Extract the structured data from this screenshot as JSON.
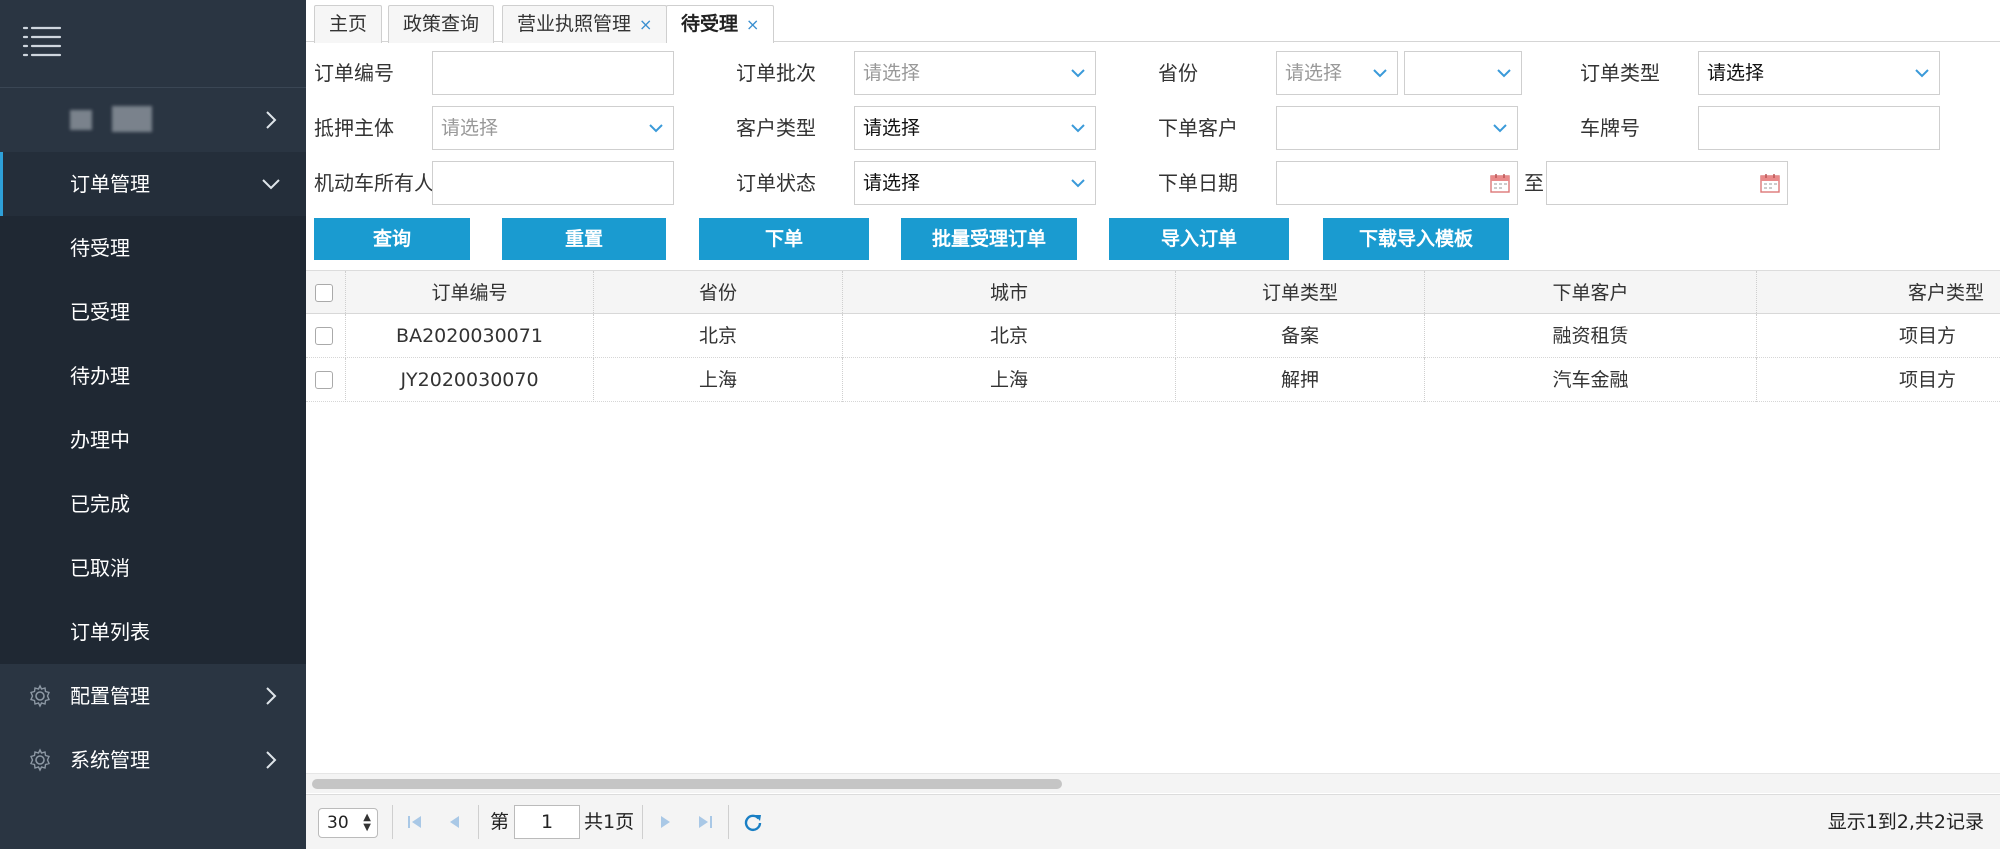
{
  "sidebar": {
    "menu_open": "订单管理",
    "sub_items": [
      "待受理",
      "已受理",
      "待办理",
      "办理中",
      "已完成",
      "已取消",
      "订单列表"
    ],
    "groups": [
      "配置管理",
      "系统管理"
    ]
  },
  "tabs": [
    {
      "label": "主页",
      "closable": false
    },
    {
      "label": "政策查询",
      "closable": false
    },
    {
      "label": "营业执照管理",
      "closable": true
    },
    {
      "label": "待受理",
      "closable": true,
      "active": true
    }
  ],
  "tab_close_glyph": "×",
  "form": {
    "order_no_label": "订单编号",
    "order_batch_label": "订单批次",
    "order_batch_placeholder": "请选择",
    "province_label": "省份",
    "province_placeholder": "请选择",
    "order_type_label": "订单类型",
    "order_type_value": "请选择",
    "pledge_label": "抵押主体",
    "pledge_placeholder": "请选择",
    "customer_type_label": "客户类型",
    "customer_type_value": "请选择",
    "order_customer_label": "下单客户",
    "plate_label": "车牌号",
    "owner_label": "机动车所有人",
    "order_status_label": "订单状态",
    "order_status_value": "请选择",
    "order_date_label": "下单日期",
    "date_to": "至"
  },
  "buttons": {
    "query": "查询",
    "reset": "重置",
    "place_order": "下单",
    "batch_accept": "批量受理订单",
    "import": "导入订单",
    "download_template": "下载导入模板"
  },
  "table": {
    "columns": [
      "订单编号",
      "省份",
      "城市",
      "订单类型",
      "下单客户",
      "客户类型"
    ],
    "rows": [
      [
        "BA2020030071",
        "北京",
        "北京",
        "备案",
        "融资租赁",
        "项目方"
      ],
      [
        "JY2020030070",
        "上海",
        "上海",
        "解押",
        "汽车金融",
        "项目方"
      ]
    ]
  },
  "pager": {
    "page_size": "30",
    "page_prefix": "第",
    "current_page": "1",
    "total_pages": "共1页",
    "info": "显示1到2,共2记录"
  },
  "colors": {
    "sidebar_bg": "#2a3542",
    "accent": "#1a9bd0",
    "active_marker": "#2ea0d8"
  }
}
